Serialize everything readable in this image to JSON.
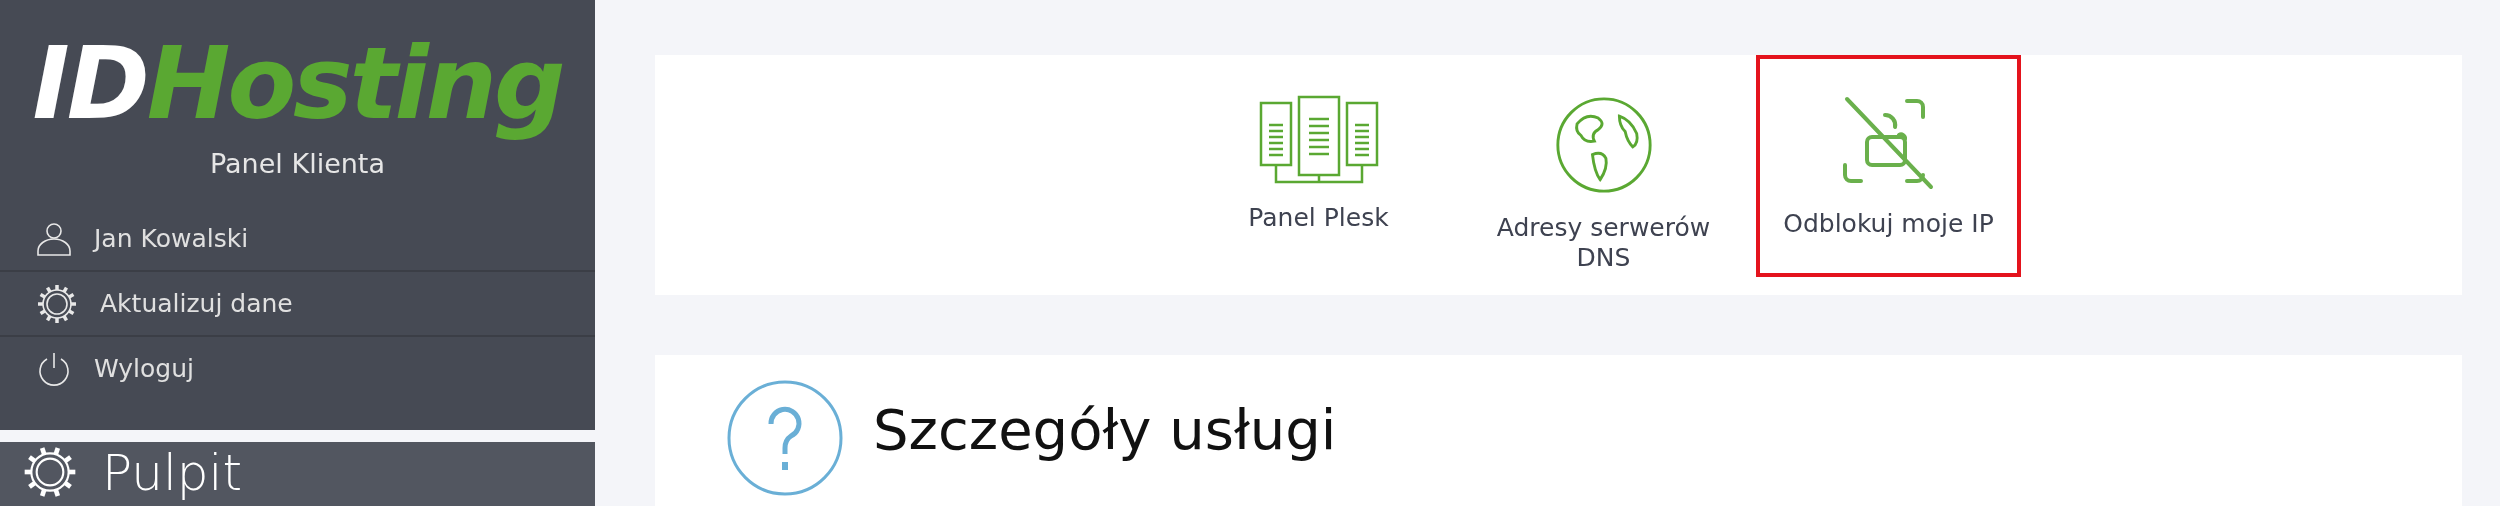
{
  "sidebar": {
    "logo": {
      "part_1": "ID",
      "part_2": "Hosting"
    },
    "subtitle": "Panel Klienta",
    "items": [
      {
        "kind": "user",
        "label": "Jan Kowalski"
      },
      {
        "kind": "gear",
        "label": "Aktualizuj dane"
      },
      {
        "kind": "power",
        "label": "Wyloguj"
      }
    ],
    "section": {
      "title": "Pulpit"
    }
  },
  "shortcuts": [
    {
      "kind": "servers",
      "label": "Panel Plesk",
      "selected": false
    },
    {
      "kind": "globe",
      "label": "Adresy serwerów DNS",
      "selected": false
    },
    {
      "kind": "unlock",
      "label": "Odblokuj moje IP",
      "selected": true
    }
  ],
  "details": {
    "title": "Szczegóły usługi"
  }
}
